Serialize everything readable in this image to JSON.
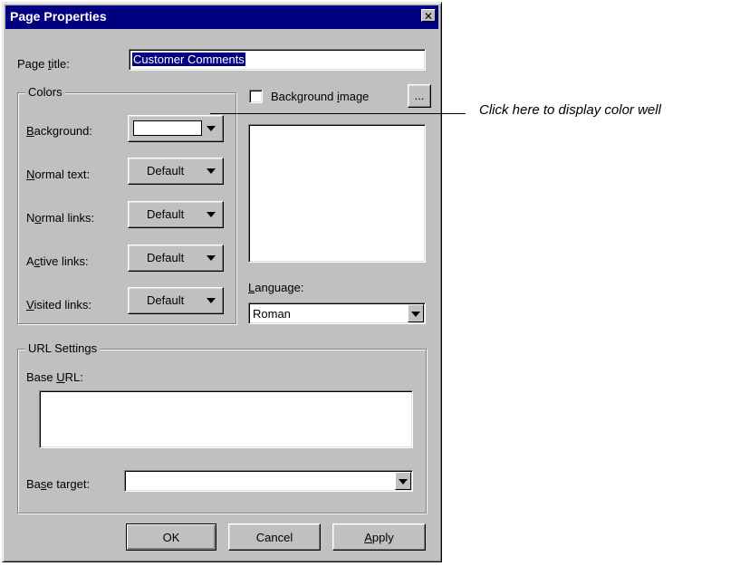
{
  "dialog": {
    "title": "Page Properties",
    "close_symbol": "✕"
  },
  "page_title": {
    "label_pre": "Page ",
    "label_ul": "t",
    "label_post": "itle:",
    "value": "Customer Comments"
  },
  "colors_group": {
    "title": "Colors",
    "rows": [
      {
        "pre": "",
        "ul": "B",
        "post": "ackground:",
        "value": ""
      },
      {
        "pre": "",
        "ul": "N",
        "post": "ormal text:",
        "value": "Default"
      },
      {
        "pre": "N",
        "ul": "o",
        "post": "rmal links:",
        "value": "Default"
      },
      {
        "pre": "A",
        "ul": "c",
        "post": "tive links:",
        "value": "Default"
      },
      {
        "pre": "",
        "ul": "V",
        "post": "isited links:",
        "value": "Default"
      }
    ]
  },
  "background_image": {
    "label_pre": "Background ",
    "label_ul": "i",
    "label_post": "mage",
    "checked": false,
    "browse_label": "..."
  },
  "language": {
    "label_pre": "",
    "label_ul": "L",
    "label_post": "anguage:",
    "value": "Roman"
  },
  "url_group": {
    "title": "URL Settings",
    "base_url_pre": "Base ",
    "base_url_ul": "U",
    "base_url_post": "RL:",
    "base_url_value": "",
    "base_target_pre": "Ba",
    "base_target_ul": "s",
    "base_target_post": "e target:",
    "base_target_value": ""
  },
  "buttons": {
    "ok": "OK",
    "cancel": "Cancel",
    "apply_ul": "A",
    "apply_post": "pply"
  },
  "callout": {
    "text": "Click here to display color well"
  }
}
